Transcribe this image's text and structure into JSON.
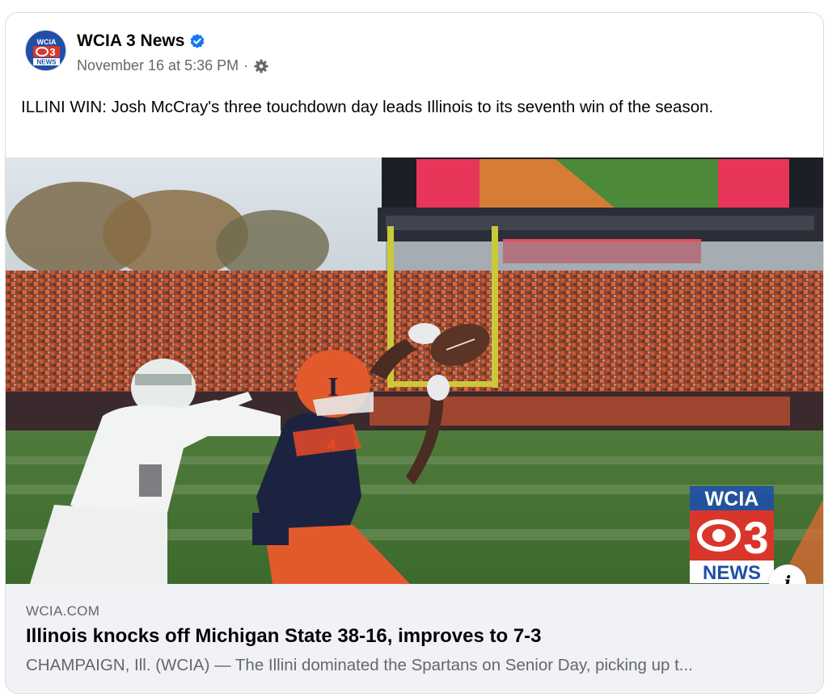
{
  "post": {
    "page_name": "WCIA 3 News",
    "verified": true,
    "timestamp": "November 16 at 5:36 PM",
    "separator": "·",
    "audience_icon": "gear-icon",
    "text": "ILLINI WIN: Josh McCray's three touchdown day leads Illinois to its seventh win of the season."
  },
  "avatar": {
    "line1": "WCIA",
    "line2": "3",
    "line3": "NEWS"
  },
  "media": {
    "watermark_top": "WCIA",
    "watermark_number": "3",
    "watermark_bottom": "NEWS",
    "info_label": "i"
  },
  "link_preview": {
    "domain": "WCIA.COM",
    "title": "Illinois knocks off Michigan State 38-16, improves to 7-3",
    "description": "CHAMPAIGN, Ill. (WCIA) — The Illini dominated the Spartans on Senior Day, picking up t..."
  },
  "colors": {
    "verified_blue": "#1877f2",
    "illini_orange": "#e84a27",
    "illini_navy": "#13294b",
    "wcia_red": "#d9362b"
  }
}
